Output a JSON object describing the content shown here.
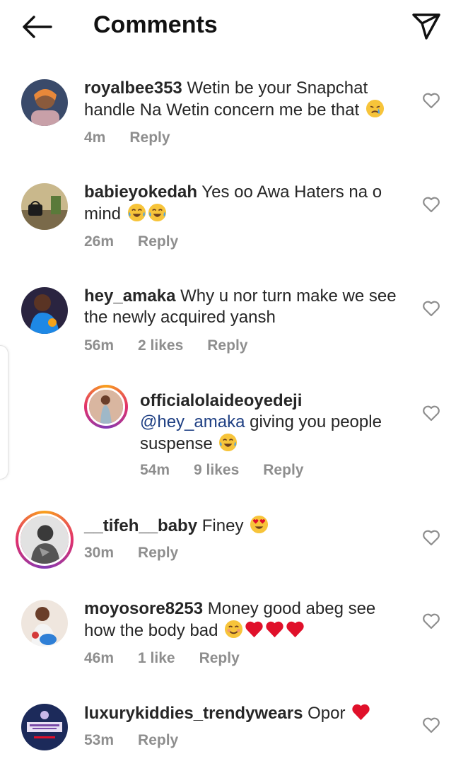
{
  "header": {
    "title": "Comments",
    "back_icon": "arrow-left-icon",
    "send_icon": "paper-plane-icon"
  },
  "comments": [
    {
      "username": "royalbee353",
      "text_line1": "Wetin be your Snapchat",
      "text_line2": "handle Na Wetin concern me be that",
      "time": "4m",
      "likes": "",
      "reply": "Reply",
      "emoji": [
        "crying-face"
      ]
    },
    {
      "username": "babieyokedah",
      "text_line1": "Yes oo Awa Haters na o",
      "text_line2": "mind",
      "time": "26m",
      "likes": "",
      "reply": "Reply",
      "emoji": [
        "tears-of-joy",
        "tears-of-joy"
      ]
    },
    {
      "username": "hey_amaka",
      "text_line1": "Why u nor turn make we see",
      "text_line2": "the newly acquired yansh",
      "time": "56m",
      "likes": "2 likes",
      "reply": "Reply",
      "emoji": []
    },
    {
      "username": "officialolaideoyedeji",
      "mention": "@hey_amaka",
      "text_line1": "giving you people",
      "text_line2": "suspense",
      "time": "54m",
      "likes": "9 likes",
      "reply": "Reply",
      "emoji": [
        "tears-of-joy"
      ]
    },
    {
      "username": "__tifeh__baby",
      "text_line1": "Finey",
      "time": "30m",
      "likes": "",
      "reply": "Reply",
      "emoji": [
        "heart-eyes"
      ]
    },
    {
      "username": "moyosore8253",
      "text_line1": "Money good abeg see",
      "text_line2": "how the body bad",
      "time": "46m",
      "likes": "1 like",
      "reply": "Reply",
      "emoji": [
        "smiling-face",
        "red-heart",
        "red-heart",
        "red-heart"
      ]
    },
    {
      "username": "luxurykiddies_trendywears",
      "text_line1": "Opor",
      "time": "53m",
      "likes": "",
      "reply": "Reply",
      "emoji": [
        "red-heart"
      ]
    }
  ],
  "colors": {
    "text": "#262626",
    "meta": "#8e8e8e",
    "mention": "#1e3f83",
    "heart_red": "#e0102a"
  }
}
